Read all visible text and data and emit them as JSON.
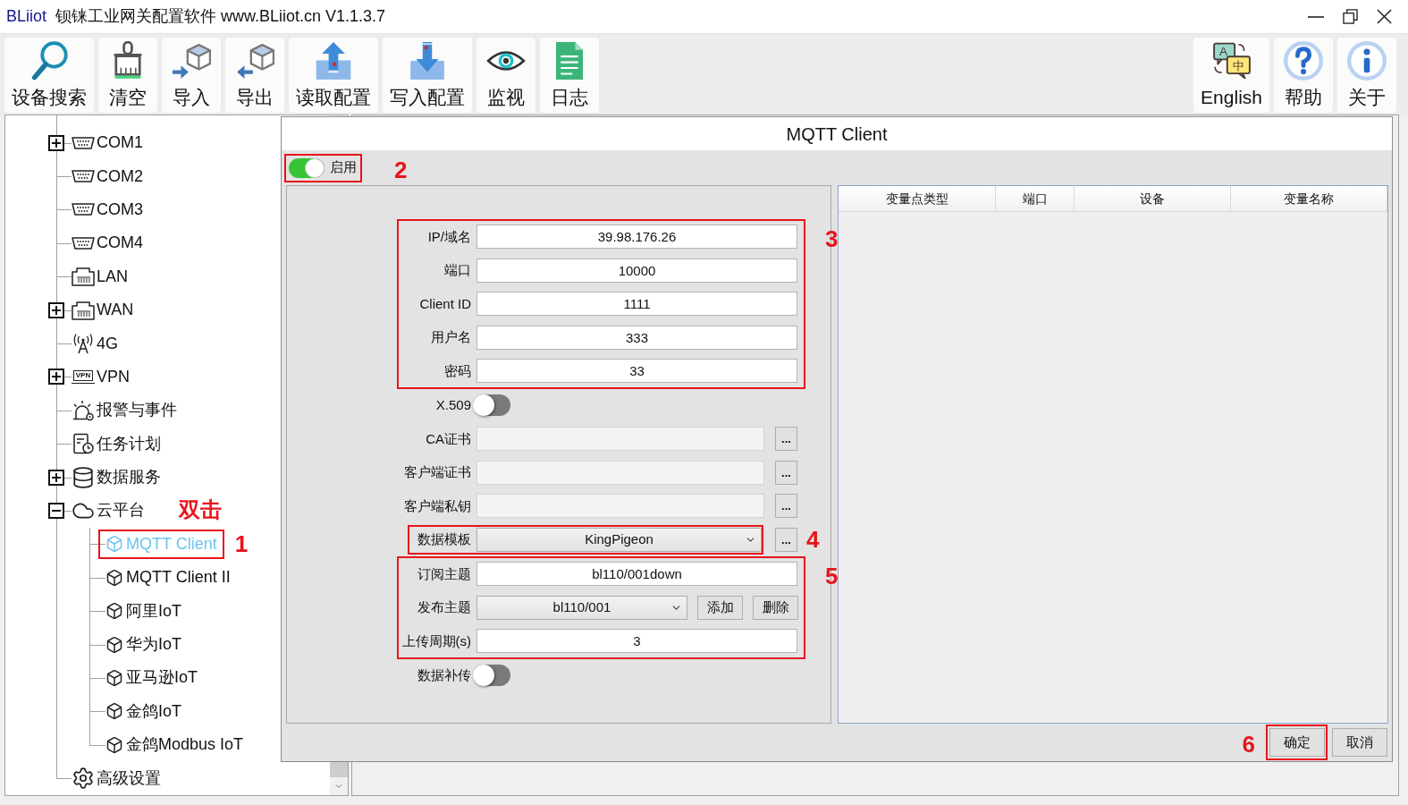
{
  "window": {
    "brand": "BLiiot",
    "title": "钡铼工业网关配置软件 www.BLiiot.cn V1.1.3.7"
  },
  "toolbar": {
    "left": [
      {
        "label": "设备搜索",
        "kind": "search"
      },
      {
        "label": "清空",
        "kind": "clear"
      },
      {
        "label": "导入",
        "kind": "import"
      },
      {
        "label": "导出",
        "kind": "export"
      },
      {
        "label": "读取配置",
        "kind": "read"
      },
      {
        "label": "写入配置",
        "kind": "write"
      },
      {
        "label": "监视",
        "kind": "monitor"
      },
      {
        "label": "日志",
        "kind": "log"
      }
    ],
    "right": [
      {
        "label": "English",
        "kind": "language",
        "icon_text": [
          "A",
          "中"
        ]
      },
      {
        "label": "帮助",
        "kind": "help"
      },
      {
        "label": "关于",
        "kind": "about"
      }
    ]
  },
  "tree": {
    "items": [
      {
        "label": "COM1",
        "kind": "serial",
        "expanded": false,
        "selected": false
      },
      {
        "label": "COM2",
        "kind": "serial",
        "selected": false
      },
      {
        "label": "COM3",
        "kind": "serial",
        "selected": false
      },
      {
        "label": "COM4",
        "kind": "serial",
        "selected": false
      },
      {
        "label": "LAN",
        "kind": "ethernet",
        "selected": false
      },
      {
        "label": "WAN",
        "kind": "ethernet",
        "expanded": false,
        "selected": false
      },
      {
        "label": "4G",
        "kind": "cellular",
        "selected": false
      },
      {
        "label": "VPN",
        "kind": "vpn",
        "badge": "VPN",
        "expanded": false,
        "selected": false
      },
      {
        "label": "报警与事件",
        "kind": "alarm",
        "selected": false
      },
      {
        "label": "任务计划",
        "kind": "schedule",
        "selected": false
      },
      {
        "label": "数据服务",
        "kind": "database",
        "expanded": false,
        "selected": false
      },
      {
        "label": "云平台",
        "kind": "cloud",
        "expanded": true,
        "selected": false,
        "children": [
          {
            "label": "MQTT Client",
            "kind": "platform",
            "selected": true,
            "callout": {
              "number": "1",
              "note": "双击"
            }
          },
          {
            "label": "MQTT Client II",
            "kind": "platform",
            "selected": false
          },
          {
            "label": "阿里IoT",
            "kind": "platform",
            "selected": false
          },
          {
            "label": "华为IoT",
            "kind": "platform",
            "selected": false
          },
          {
            "label": "亚马逊IoT",
            "kind": "platform",
            "selected": false
          },
          {
            "label": "金鸽IoT",
            "kind": "platform",
            "selected": false
          },
          {
            "label": "金鸽Modbus IoT",
            "kind": "platform",
            "selected": false
          }
        ]
      },
      {
        "label": "高级设置",
        "kind": "settings",
        "selected": false
      }
    ]
  },
  "dialog": {
    "title": "MQTT Client",
    "enable": {
      "label": "启用",
      "on": true,
      "callout": "2"
    },
    "sections": [
      {
        "callout": "3",
        "fields": [
          {
            "kind": "text",
            "label": "IP/域名",
            "value": "39.98.176.26",
            "disabled": false
          },
          {
            "kind": "text",
            "label": "端口",
            "value": "10000",
            "disabled": false
          },
          {
            "kind": "text",
            "label": "Client ID",
            "value": "1111",
            "disabled": false
          },
          {
            "kind": "text",
            "label": "用户名",
            "value": "333",
            "disabled": false
          },
          {
            "kind": "text",
            "label": "密码",
            "value": "33",
            "disabled": false
          }
        ]
      },
      {
        "fields": [
          {
            "kind": "toggle",
            "label": "X.509",
            "on": false
          },
          {
            "kind": "file",
            "label": "CA证书",
            "disabled": true,
            "browse": "..."
          },
          {
            "kind": "file",
            "label": "客户端证书",
            "disabled": true,
            "browse": "..."
          },
          {
            "kind": "file",
            "label": "客户端私钥",
            "disabled": true,
            "browse": "..."
          },
          {
            "kind": "select",
            "label": "数据模板",
            "value": "KingPigeon",
            "browse": "...",
            "callout": "4"
          }
        ]
      },
      {
        "callout": "5",
        "fields": [
          {
            "kind": "text",
            "label": "订阅主题",
            "value": "bl110/001down",
            "disabled": false
          },
          {
            "kind": "select",
            "label": "发布主题",
            "value": "bl110/001",
            "buttons": [
              "添加",
              "删除"
            ]
          },
          {
            "kind": "text",
            "label": "上传周期(s)",
            "value": "3",
            "disabled": false
          }
        ]
      },
      {
        "fields": [
          {
            "kind": "toggle",
            "label": "数据补传",
            "on": false
          }
        ]
      }
    ],
    "table": {
      "columns": [
        "变量点类型",
        "端口",
        "设备",
        "变量名称"
      ]
    },
    "buttons": [
      {
        "label": "确定",
        "callout": "6"
      },
      {
        "label": "取消"
      }
    ]
  }
}
